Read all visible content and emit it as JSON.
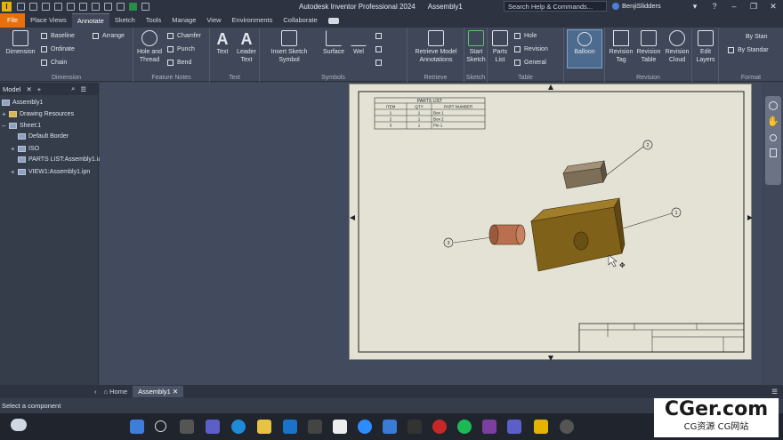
{
  "window": {
    "app_name": "Autodesk Inventor Professional 2024",
    "doc_name": "Assembly1",
    "search_placeholder": "Search Help & Commands...",
    "user_name": "BenjiSlidders"
  },
  "menu": {
    "tabs": [
      "File",
      "Place Views",
      "Annotate",
      "Sketch",
      "Tools",
      "Manage",
      "View",
      "Environments",
      "Collaborate"
    ],
    "active_tab": "Annotate"
  },
  "ribbon": {
    "dimension": {
      "big": "Dimension",
      "baseline": "Baseline",
      "ordinate": "Ordinate",
      "chain": "Chain",
      "arrange": "Arrange",
      "label": "Dimension"
    },
    "feature_notes": {
      "hole_thread": "Hole and Thread",
      "chamfer": "Chamfer",
      "punch": "Punch",
      "bend": "Bend",
      "label": "Feature Notes"
    },
    "text": {
      "text": "Text",
      "leader_text": "Leader Text",
      "label": "Text"
    },
    "symbols": {
      "insert_sketch_symbol": "Insert Sketch Symbol",
      "surface": "Surface",
      "weld": "Wel",
      "label": "Symbols"
    },
    "retrieve": {
      "retrieve_model": "Retrieve Model Annotations",
      "label": "Retrieve"
    },
    "sketch": {
      "start_sketch": "Start Sketch",
      "label": "Sketch"
    },
    "table": {
      "parts_list": "Parts List",
      "hole": "Hole",
      "revision": "Revision",
      "general": "General",
      "label": "Table"
    },
    "balloon": {
      "label": "Balloon"
    },
    "revision": {
      "tag": "Revision Tag",
      "table": "Revision Table",
      "cloud": "Revision Cloud",
      "label": "Revision"
    },
    "layers": {
      "edit_layers": "Edit Layers"
    },
    "format": {
      "by_standard_1": "By Stan",
      "by_standard_2": "By Standar",
      "label": "Format"
    }
  },
  "browser": {
    "tab_label": "Model",
    "items": [
      "Assembly1",
      "Drawing Resources",
      "Sheet:1",
      "Default Border",
      "ISO",
      "PARTS LIST:Assembly1.ia",
      "VIEW1:Assembly1.ipn"
    ]
  },
  "parts_list": {
    "title": "PARTS LIST",
    "headers": [
      "ITEM",
      "QTY",
      "PART NUMBER"
    ],
    "rows": [
      [
        "1",
        "1",
        "Box 1"
      ],
      [
        "2",
        "1",
        "Box 2"
      ],
      [
        "3",
        "1",
        "Pin 1"
      ]
    ]
  },
  "balloons": [
    "1",
    "2",
    "3"
  ],
  "doc_tabs": {
    "home": "Home",
    "active": "Assembly1"
  },
  "status": {
    "text": "Select a component"
  },
  "watermark": {
    "big": "CGer.com",
    "small": "CG资源 CG网站"
  },
  "colors": {
    "accent": "#e8700c",
    "box_main": "#8a6a1d",
    "box_small": "#8a7a63",
    "pin": "#b96c4d",
    "sheet": "#e3e2d5"
  }
}
